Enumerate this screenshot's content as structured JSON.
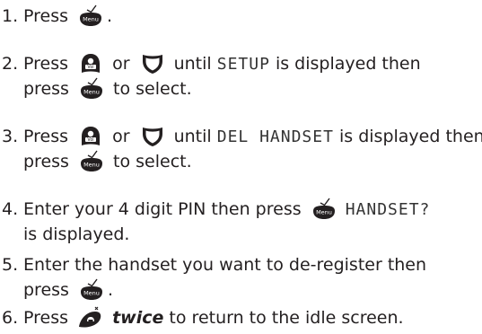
{
  "steps": [
    {
      "number": "1.",
      "lines": [
        [
          "Press ",
          {
            "icon": "menu"
          },
          "."
        ]
      ]
    },
    {
      "number": "2.",
      "lines": [
        [
          "Press ",
          {
            "icon": "volume-up"
          },
          " or ",
          {
            "icon": "down"
          },
          " until ",
          {
            "lcd": "SETUP"
          },
          " is displayed then"
        ],
        [
          "press ",
          {
            "icon": "menu"
          },
          " to select."
        ]
      ]
    },
    {
      "number": "3.",
      "lines": [
        [
          "Press ",
          {
            "icon": "volume-up"
          },
          " or ",
          {
            "icon": "down"
          },
          " until ",
          {
            "lcd": "DEL HANDSET"
          },
          " is displayed then"
        ],
        [
          "press ",
          {
            "icon": "menu"
          },
          " to select."
        ]
      ]
    },
    {
      "number": "4.",
      "lines": [
        [
          "Enter your 4 digit PIN then press ",
          {
            "icon": "menu"
          },
          " ",
          {
            "lcd": "HANDSET?"
          }
        ],
        [
          "is displayed."
        ]
      ]
    },
    {
      "number": "5.",
      "lines": [
        [
          "Enter the handset you want to de-register then"
        ],
        [
          "press ",
          {
            "icon": "menu"
          },
          "."
        ]
      ]
    },
    {
      "number": "6.",
      "lines": [
        [
          "Press ",
          {
            "icon": "end-call"
          },
          " ",
          {
            "em": "twice"
          },
          " to return to the idle screen."
        ]
      ]
    }
  ],
  "icons": {
    "menu": {
      "name": "menu-button-icon",
      "label": "Menu",
      "color": "#231f20"
    },
    "volume-up": {
      "name": "volume-up-button-icon",
      "label": "Vol",
      "color": "#231f20"
    },
    "down": {
      "name": "down-button-icon",
      "color": "#231f20"
    },
    "end-call": {
      "name": "end-call-button-icon",
      "color": "#231f20"
    }
  }
}
